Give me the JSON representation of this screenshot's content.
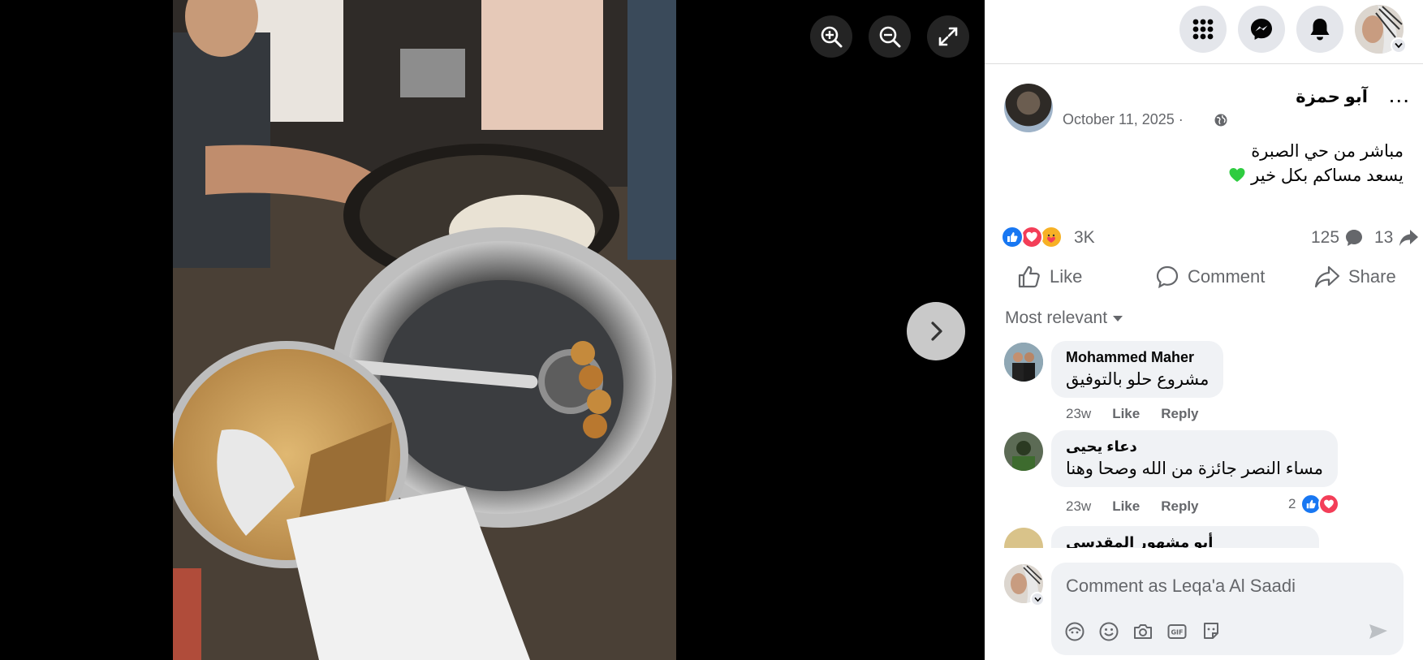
{
  "post": {
    "author": "آبو حمزة",
    "date": "October 11, 2025 ·",
    "more_label": "...",
    "text_line1": "مباشر من حي الصبرة",
    "text_line2": "يسعد مساكم بكل خير",
    "reactions_count": "3K",
    "comments_count": "125",
    "shares_count": "13"
  },
  "actions": {
    "like": "Like",
    "comment": "Comment",
    "share": "Share"
  },
  "sort_label": "Most relevant",
  "comments": [
    {
      "name": "Mohammed Maher",
      "text": "مشروع حلو بالتوفيق",
      "time": "23w",
      "like": "Like",
      "reply": "Reply"
    },
    {
      "name": "دعاء يحيى",
      "text": "مساء النصر جائزة من الله وصحا وهنا",
      "time": "23w",
      "like": "Like",
      "reply": "Reply",
      "reaction_count": "2"
    },
    {
      "name": "أبو مشهور المقدسي"
    }
  ],
  "composer": {
    "placeholder": "Comment as Leqa'a Al Saadi"
  },
  "colors": {
    "accent": "#1877f2",
    "love": "#f33e58",
    "heart_green": "#2ecc40"
  }
}
